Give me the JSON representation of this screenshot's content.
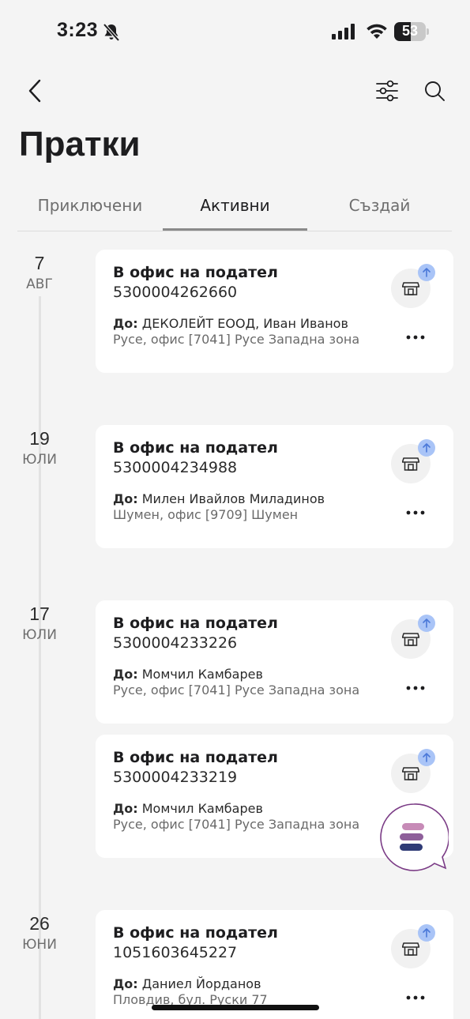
{
  "status_bar": {
    "time": "3:23",
    "battery": "53",
    "battery_level": 0.53
  },
  "page": {
    "title": "Пратки"
  },
  "tabs": [
    {
      "label": "Приключени"
    },
    {
      "label": "Активни",
      "active": true
    },
    {
      "label": "Създай"
    }
  ],
  "groups": [
    {
      "day": "7",
      "month": "АВГ"
    },
    {
      "day": "19",
      "month": "ЮЛИ"
    },
    {
      "day": "17",
      "month": "ЮЛИ"
    },
    {
      "day": "26",
      "month": "ЮНИ"
    }
  ],
  "recipient_label": "До:",
  "shipments": [
    {
      "status": "В офис на подател",
      "number": "5300004262660",
      "recipient": "ДЕКОЛЕЙТ ЕООД, Иван Иванов",
      "address": "Русе, офис [7041] Русе Западна зона"
    },
    {
      "status": "В офис на подател",
      "number": "5300004234988",
      "recipient": "Милен Ивайлов Миладинов",
      "address": "Шумен, офис [9709] Шумен"
    },
    {
      "status": "В офис на подател",
      "number": "5300004233226",
      "recipient": "Момчил Камбарев",
      "address": "Русе, офис [7041] Русе Западна зона"
    },
    {
      "status": "В офис на подател",
      "number": "5300004233219",
      "recipient": "Момчил Камбарев",
      "address": "Русе, офис [7041] Русе Западна зона"
    },
    {
      "status": "В офис на подател",
      "number": "1051603645227",
      "recipient": "Даниел Йорданов",
      "address": "Пловдив, бул. Руски 77"
    }
  ],
  "colors": {
    "accent_badge": "#a9c4f7",
    "fab_border": "#7b3c86",
    "fab_pink": "#c78bb7",
    "fab_mauve": "#8e5f9a",
    "fab_navy": "#2f3b76"
  },
  "icons": {
    "back": "chevron-left-icon",
    "filter": "sliders-icon",
    "search": "search-icon",
    "card": "shop-icon",
    "badge": "arrow-up-icon",
    "more": "more-icon",
    "chat": "chat-logo-icon"
  }
}
